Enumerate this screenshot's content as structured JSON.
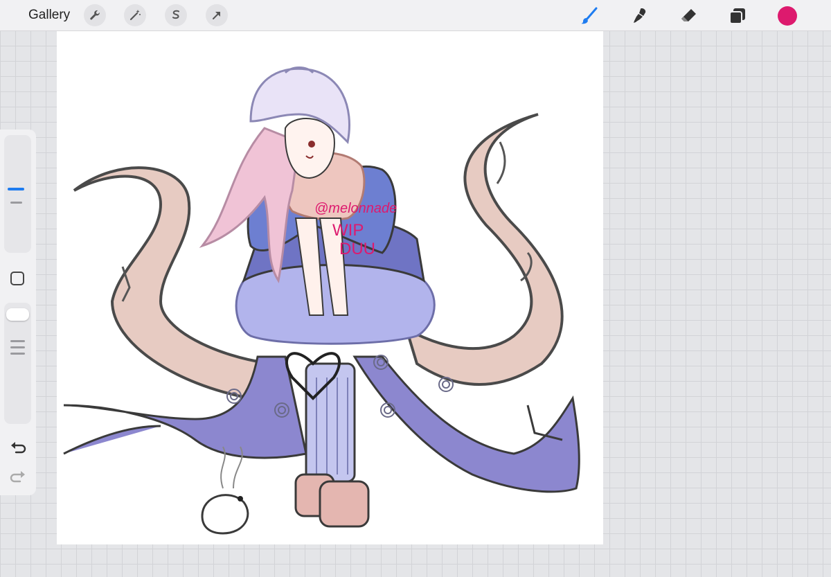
{
  "toolbar": {
    "gallery_label": "Gallery",
    "left_tools": [
      "wrench-icon",
      "magic-wand-icon",
      "selection-s-icon",
      "transform-arrow-icon"
    ],
    "right_tools": [
      "brush-icon",
      "smudge-icon",
      "eraser-icon",
      "layers-icon"
    ],
    "active_tool": "brush",
    "current_color": "#dd1a6e"
  },
  "canvas": {
    "watermark_handle": "@melonnade",
    "watermark_wip": "WIP",
    "watermark_duu": "DUU"
  },
  "sidebar": {
    "brush_size_level": 0.22,
    "brush_opacity_level": 0.0,
    "controls": [
      "brush-size-slider",
      "modify-button",
      "opacity-slider",
      "undo-button",
      "redo-button"
    ]
  },
  "colors": {
    "accent_blue": "#1e7cf0",
    "brush_color": "#dd1a6e"
  }
}
